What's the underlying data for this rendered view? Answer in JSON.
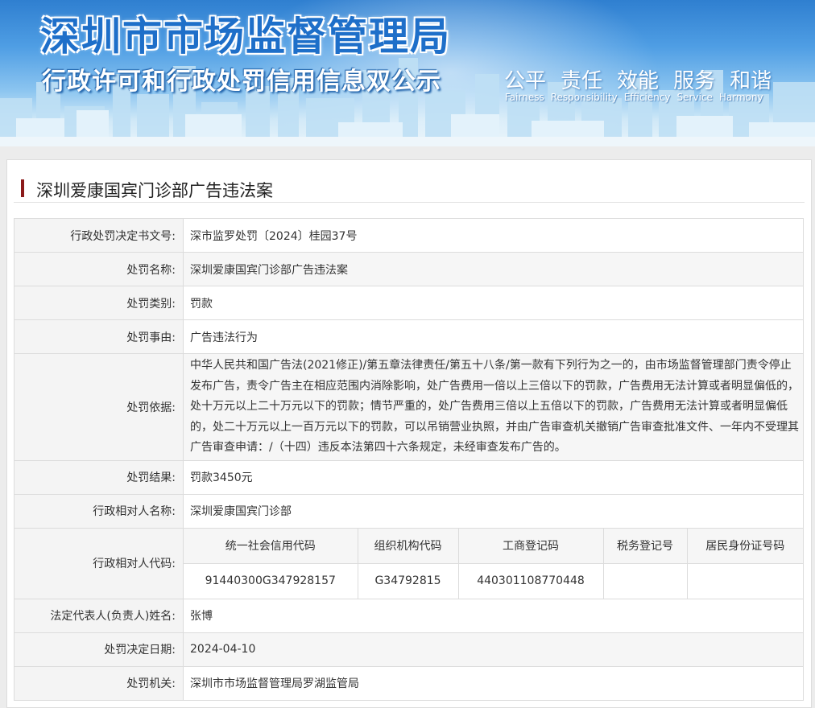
{
  "banner": {
    "title": "深圳市市场监督管理局",
    "subtitle": "行政许可和行政处罚信用信息双公示",
    "motto_cn": [
      "公平",
      "责任",
      "效能",
      "服务",
      "和谐"
    ],
    "motto_en": [
      "Fairness",
      "Responsibility",
      "Efficiency",
      "Service",
      "Harmony"
    ]
  },
  "case_title": "深圳爱康国宾门诊部广告违法案",
  "fields": {
    "decision_no_label": "行政处罚决定书文号:",
    "decision_no": "深市监罗处罚〔2024〕桂园37号",
    "penalty_name_label": "处罚名称:",
    "penalty_name": "深圳爱康国宾门诊部广告违法案",
    "penalty_type_label": "处罚类别:",
    "penalty_type": "罚款",
    "reason_label": "处罚事由:",
    "reason": "广告违法行为",
    "basis_label": "处罚依据:",
    "basis": "中华人民共和国广告法(2021修正)/第五章法律责任/第五十八条/第一款有下列行为之一的，由市场监督管理部门责令停止发布广告，责令广告主在相应范围内消除影响，处广告费用一倍以上三倍以下的罚款，广告费用无法计算或者明显偏低的，处十万元以上二十万元以下的罚款；情节严重的，处广告费用三倍以上五倍以下的罚款，广告费用无法计算或者明显偏低的，处二十万元以上一百万元以下的罚款，可以吊销营业执照，并由广告审查机关撤销广告审查批准文件、一年内不受理其广告审查申请：/（十四）违反本法第四十六条规定，未经审查发布广告的。",
    "result_label": "处罚结果:",
    "result": "罚款3450元",
    "party_name_label": "行政相对人名称:",
    "party_name": "深圳爱康国宾门诊部",
    "party_code_label": "行政相对人代码:",
    "codes": {
      "headers": [
        "统一社会信用代码",
        "组织机构代码",
        "工商登记码",
        "税务登记号",
        "居民身份证号码"
      ],
      "values": [
        "91440300G347928157",
        "G34792815",
        "440301108770448",
        "",
        ""
      ]
    },
    "legal_rep_label": "法定代表人(负责人)姓名:",
    "legal_rep": "张博",
    "decision_date_label": "处罚决定日期:",
    "decision_date": "2024-04-10",
    "authority_label": "处罚机关:",
    "authority": "深圳市市场监督管理局罗湖监管局"
  }
}
